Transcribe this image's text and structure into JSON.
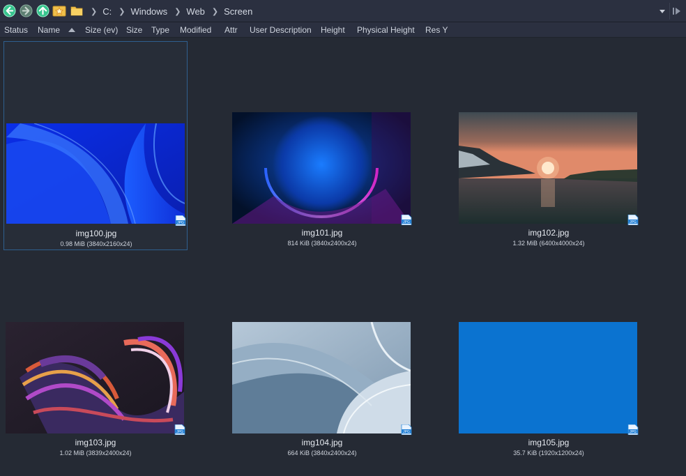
{
  "breadcrumb": [
    "C:",
    "Windows",
    "Web",
    "Screen"
  ],
  "columns": [
    "Status",
    "Name",
    "Size (ev)",
    "Size",
    "Type",
    "Modified",
    "Attr",
    "User Description",
    "Height",
    "Physical Height",
    "Res Y"
  ],
  "sort": {
    "column": "Name",
    "direction": "ascending"
  },
  "files": [
    {
      "name": "img100.jpg",
      "info": "0.98 MiB (3840x2160x24)",
      "badge": "JPG",
      "selected": true
    },
    {
      "name": "img101.jpg",
      "info": "814 KiB (3840x2400x24)",
      "badge": "JPG",
      "selected": false
    },
    {
      "name": "img102.jpg",
      "info": "1.32 MiB (6400x4000x24)",
      "badge": "JPG",
      "selected": false
    },
    {
      "name": "img103.jpg",
      "info": "1.02 MiB (3839x2400x24)",
      "badge": "JPG",
      "selected": false
    },
    {
      "name": "img104.jpg",
      "info": "664 KiB (3840x2400x24)",
      "badge": "JPG",
      "selected": false
    },
    {
      "name": "img105.jpg",
      "info": "35.7 KiB (1920x1200x24)",
      "badge": "JPG",
      "selected": false
    }
  ],
  "icons": {
    "back": "arrow-left-circle",
    "forward": "arrow-right-circle",
    "up": "arrow-up-circle",
    "favorite": "star-folder",
    "folder": "folder",
    "dropdown": "triangle-down",
    "panel": "panel-toggle",
    "sort": "triangle-up"
  },
  "colors": {
    "background": "#252a34",
    "toolbar": "#2b3040",
    "accent": "#2f5f8f",
    "solid_wallpaper": "#0b73d0"
  }
}
